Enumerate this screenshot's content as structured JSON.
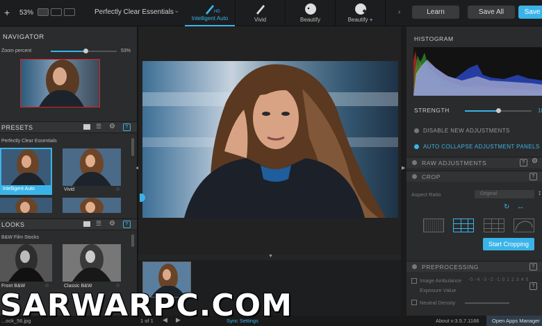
{
  "topbar": {
    "zoom": "53%",
    "preset_name": "Perfectly Clear Essentials",
    "modes": [
      {
        "label": "Intelligent Auto",
        "icon": "brush-hd-icon",
        "active": true
      },
      {
        "label": "Vivid",
        "icon": "brush-icon"
      },
      {
        "label": "Beautify",
        "icon": "face-icon"
      },
      {
        "label": "Beautify +",
        "icon": "face-plus-icon"
      }
    ],
    "learn": "Learn",
    "save_all": "Save All",
    "save": "Save",
    "hd_badge": "HD"
  },
  "navigator": {
    "title": "NAVIGATOR",
    "zoom_label": "Zoom percent",
    "zoom_value": "53%",
    "zoom_fraction": 0.53
  },
  "presets": {
    "title": "PRESETS",
    "group": "Perfectly Clear Essentials",
    "items": [
      {
        "label": "Intelligent Auto",
        "selected": true
      },
      {
        "label": "Vivid",
        "selected": false
      }
    ]
  },
  "looks": {
    "title": "LOOKS",
    "group": "B&W Film Stocks",
    "items": [
      {
        "label": "Front B&W"
      },
      {
        "label": "Classic B&W"
      }
    ]
  },
  "right": {
    "histogram_title": "HISTOGRAM",
    "strength_label": "STRENGTH",
    "strength_value": "10",
    "strength_fraction": 0.5,
    "disable_new": "DISABLE NEW ADJUSTMENTS",
    "auto_collapse": "AUTO COLLAPSE ADJUSTMENT PANELS",
    "raw_adjustments": "RAW ADJUSTMENTS",
    "crop": "CROP",
    "aspect_ratio_label": "Aspect Ratio",
    "aspect_ratio_value": "Original",
    "start_cropping": "Start Cropping",
    "preprocessing": "PREPROCESSING",
    "image_ambulance": "Image Ambulance",
    "exposure_value": "Exposure Value",
    "exposure_scale": "-5 -4 -3 -2 -1 0 1 2 3 4 5",
    "neutral_density": "Neutral Density"
  },
  "status": {
    "filename": "...ock_56.jpg",
    "pages": "1 of 1",
    "sync": "Sync Settings",
    "version": "About v:3.5.7.1166",
    "open_apps": "Open Apps Manager"
  },
  "watermark": "SARWARPC.COM",
  "colors": {
    "accent": "#3ab4e8",
    "selected_border": "#e02020"
  }
}
